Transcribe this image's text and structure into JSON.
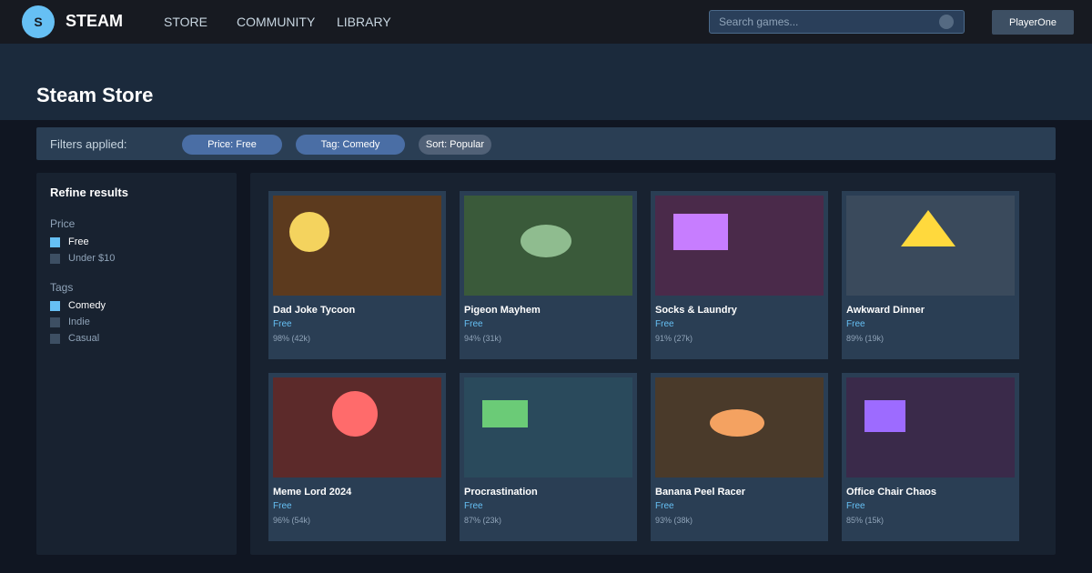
{
  "app": {
    "logo_letter": "S",
    "name": "STEAM",
    "brand_color": "#66c0f4"
  },
  "nav": {
    "items": [
      {
        "label": "STORE"
      },
      {
        "label": "COMMUNITY"
      },
      {
        "label": "LIBRARY"
      }
    ],
    "search": {
      "placeholder": "Search games...",
      "value": "",
      "icon": "search-icon"
    },
    "user": {
      "label": "PlayerOne"
    }
  },
  "page": {
    "title": "Steam Store"
  },
  "filters": {
    "label": "Filters applied:",
    "chips": [
      {
        "label": "Price: Free"
      },
      {
        "label": "Tag: Comedy"
      },
      {
        "label": "Sort: Popular"
      }
    ]
  },
  "sidebar": {
    "title": "Refine results",
    "sections": [
      {
        "label": "Price",
        "options": [
          {
            "label": "Free",
            "checked": true
          },
          {
            "label": "Under $10",
            "checked": false
          }
        ]
      },
      {
        "label": "Tags",
        "options": [
          {
            "label": "Comedy",
            "checked": true
          },
          {
            "label": "Indie",
            "checked": false
          },
          {
            "label": "Casual",
            "checked": false
          }
        ]
      }
    ]
  },
  "games": [
    {
      "name": "Dad Joke Tycoon",
      "price": "Free",
      "rating": "98% (42k)",
      "thumb_bg": "#5c3a1e",
      "shape": "circle",
      "shape_color": "#f4d35e"
    },
    {
      "name": "Pigeon Mayhem",
      "price": "Free",
      "rating": "94% (31k)",
      "thumb_bg": "#3a5a3a",
      "shape": "ellipse",
      "shape_color": "#8fbc8f"
    },
    {
      "name": "Socks & Laundry",
      "price": "Free",
      "rating": "91% (27k)",
      "thumb_bg": "#4a2a4a",
      "shape": "rect",
      "shape_color": "#c77dff"
    },
    {
      "name": "Awkward Dinner",
      "price": "Free",
      "rating": "89% (19k)",
      "thumb_bg": "#3a4a5c",
      "shape": "triangle",
      "shape_color": "#ffd93d"
    },
    {
      "name": "Meme Lord 2024",
      "price": "Free",
      "rating": "96% (54k)",
      "thumb_bg": "#5c2a2a",
      "shape": "circle",
      "shape_color": "#ff6b6b"
    },
    {
      "name": "Procrastination",
      "price": "Free",
      "rating": "87% (23k)",
      "thumb_bg": "#2a4a5c",
      "shape": "rect",
      "shape_color": "#6bcb77"
    },
    {
      "name": "Banana Peel Racer",
      "price": "Free",
      "rating": "93% (38k)",
      "thumb_bg": "#4a3a2a",
      "shape": "ellipse",
      "shape_color": "#f4a261"
    },
    {
      "name": "Office Chair Chaos",
      "price": "Free",
      "rating": "85% (15k)",
      "thumb_bg": "#3a2a4a",
      "shape": "square",
      "shape_color": "#9d6bff"
    }
  ]
}
